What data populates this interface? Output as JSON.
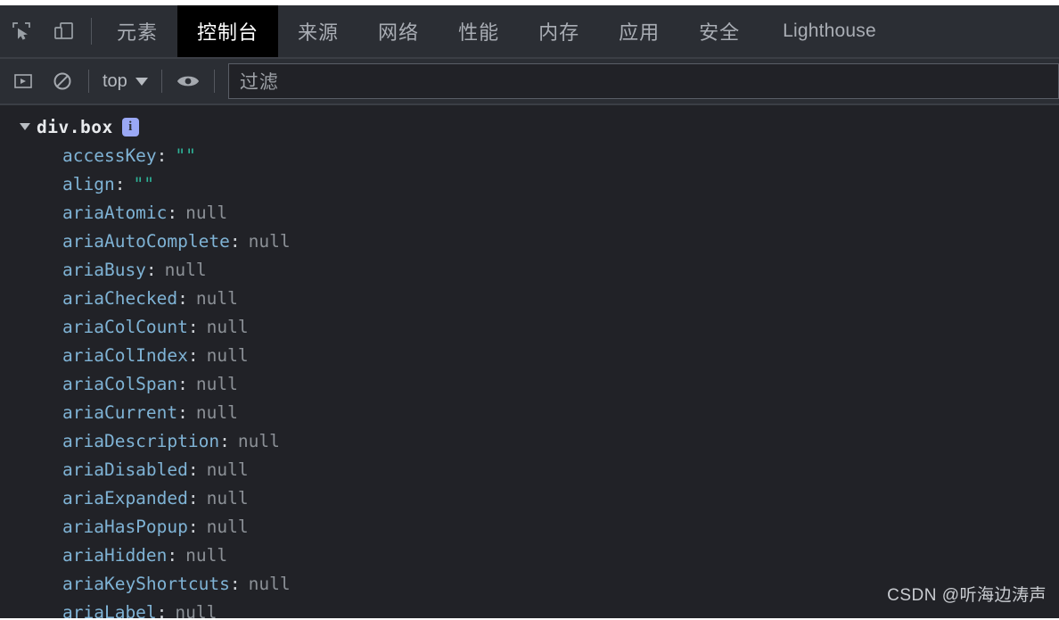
{
  "tabbar": {
    "inspect_icon": "inspect-element-icon",
    "device_icon": "device-toolbar-icon",
    "tabs": [
      {
        "label": "元素",
        "active": false,
        "latin": false
      },
      {
        "label": "控制台",
        "active": true,
        "latin": false
      },
      {
        "label": "来源",
        "active": false,
        "latin": false
      },
      {
        "label": "网络",
        "active": false,
        "latin": false
      },
      {
        "label": "性能",
        "active": false,
        "latin": false
      },
      {
        "label": "内存",
        "active": false,
        "latin": false
      },
      {
        "label": "应用",
        "active": false,
        "latin": false
      },
      {
        "label": "安全",
        "active": false,
        "latin": false
      },
      {
        "label": "Lighthouse",
        "active": false,
        "latin": true
      }
    ]
  },
  "console_toolbar": {
    "sidebar_icon": "console-sidebar-icon",
    "clear_icon": "clear-console-icon",
    "context_value": "top",
    "context_caret_icon": "chevron-down-icon",
    "eye_icon": "live-expression-eye-icon",
    "filter_placeholder": "过滤"
  },
  "console": {
    "node": {
      "expander_icon": "collapse-triangle-icon",
      "name": "div.box",
      "badge_icon": "info-badge-icon",
      "badge_text": "i"
    },
    "properties": [
      {
        "name": "accessKey",
        "value": "\"\"",
        "kind": "str"
      },
      {
        "name": "align",
        "value": "\"\"",
        "kind": "str"
      },
      {
        "name": "ariaAtomic",
        "value": "null",
        "kind": "null"
      },
      {
        "name": "ariaAutoComplete",
        "value": "null",
        "kind": "null"
      },
      {
        "name": "ariaBusy",
        "value": "null",
        "kind": "null"
      },
      {
        "name": "ariaChecked",
        "value": "null",
        "kind": "null"
      },
      {
        "name": "ariaColCount",
        "value": "null",
        "kind": "null"
      },
      {
        "name": "ariaColIndex",
        "value": "null",
        "kind": "null"
      },
      {
        "name": "ariaColSpan",
        "value": "null",
        "kind": "null"
      },
      {
        "name": "ariaCurrent",
        "value": "null",
        "kind": "null"
      },
      {
        "name": "ariaDescription",
        "value": "null",
        "kind": "null"
      },
      {
        "name": "ariaDisabled",
        "value": "null",
        "kind": "null"
      },
      {
        "name": "ariaExpanded",
        "value": "null",
        "kind": "null"
      },
      {
        "name": "ariaHasPopup",
        "value": "null",
        "kind": "null"
      },
      {
        "name": "ariaHidden",
        "value": "null",
        "kind": "null"
      },
      {
        "name": "ariaKeyShortcuts",
        "value": "null",
        "kind": "null"
      },
      {
        "name": "ariaLabel",
        "value": "null",
        "kind": "null"
      }
    ]
  },
  "watermark": {
    "text": "CSDN @听海边涛声"
  },
  "colors": {
    "chrome_bg": "#2b2e34",
    "console_bg": "#212227",
    "active_tab_bg": "#000000",
    "property_name": "#7fb3d5",
    "string_value": "#2eb398",
    "null_value": "#8b9096",
    "badge": "#9aa8f5"
  }
}
